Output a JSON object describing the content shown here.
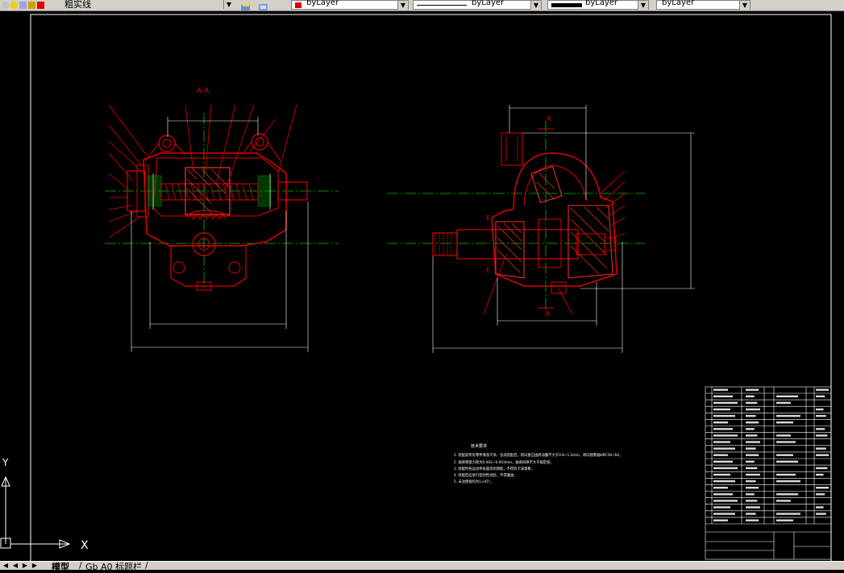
{
  "toolbar": {
    "layer_name": "粗实线",
    "color_control": "byLayer",
    "linetype_control": "byLayer",
    "lineweight_control": "byLayer",
    "plotstyle_control": "byLayer",
    "colors": {
      "red": "#e00000",
      "toolbar_bg": "#d4d0c8"
    }
  },
  "drawing": {
    "section_label": "A-A",
    "view_arrow_top": "A",
    "view_arrow_bottom": "A",
    "cut_mark_e1": "E",
    "cut_mark_e2": "E",
    "tech_requirements": {
      "title": "技术要求",
      "lines": [
        "1. 装配前所有零件清洗干净，总成装配后，转向盘自由转动量不大于0.8~1.2mm，转向摇臂轴HRC58~64；",
        "2. 轴承预紧力矩为0.002~0.003mm，轴承间隙不大于规定值；",
        "3. 装配时各运动件表面涂润滑脂，不得有卡滞现象；",
        "4. 装配后应进行密封性试验，不得漏油；",
        "5. 未注倒角均为1×45°。"
      ]
    },
    "ucs": {
      "x_label": "X",
      "y_label": "Y"
    }
  },
  "tabs": {
    "model": "模型",
    "layout1": "Gb A0 标题栏",
    "separator": "/",
    "nav": [
      "◀",
      "◀",
      "▶",
      "▶"
    ]
  },
  "colors": {
    "background": "#000000",
    "part": "#e00000",
    "dim": "#ffffff",
    "center": "#00c000",
    "hatch": "#ff3030"
  }
}
